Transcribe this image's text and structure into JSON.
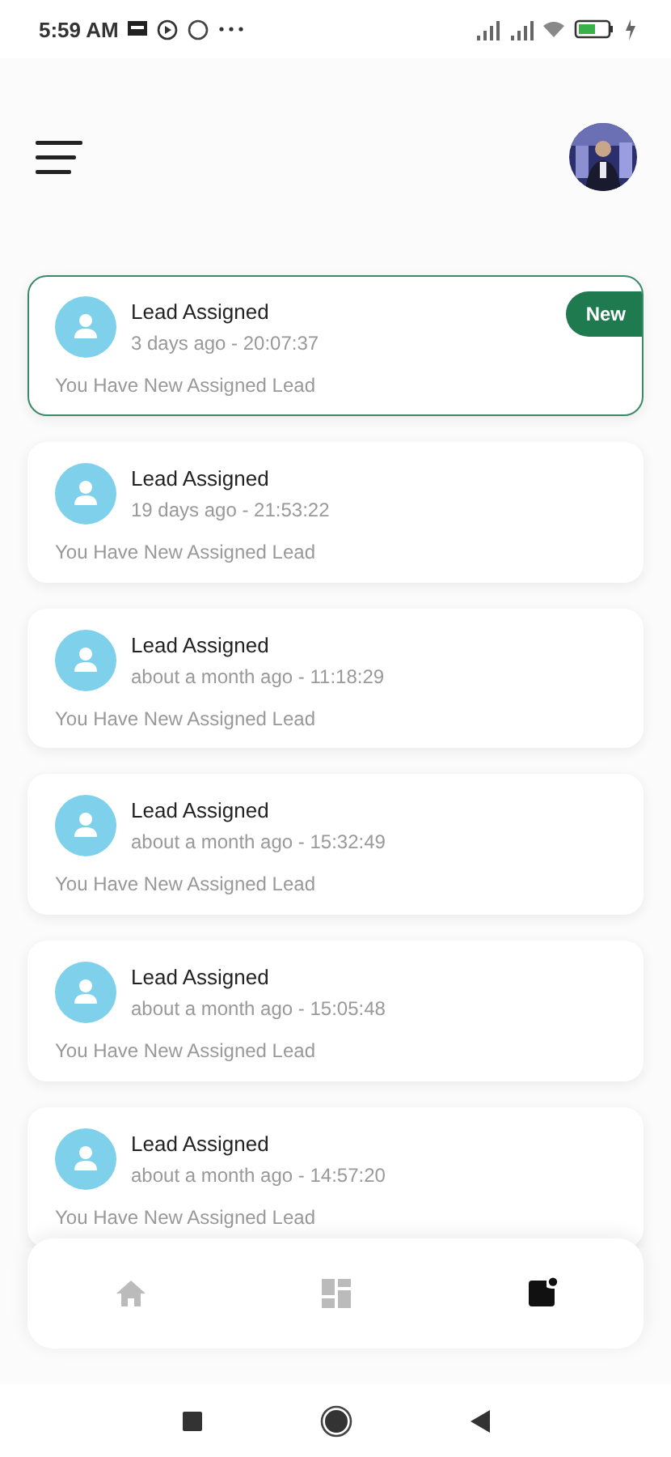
{
  "status_bar": {
    "time": "5:59 AM"
  },
  "new_badge": "New",
  "notifications": [
    {
      "title": "Lead Assigned",
      "time": "3 days ago - 20:07:37",
      "message": "You Have New Assigned Lead",
      "new": true
    },
    {
      "title": "Lead Assigned",
      "time": "19 days ago - 21:53:22",
      "message": "You Have New Assigned Lead",
      "new": false
    },
    {
      "title": "Lead Assigned",
      "time": "about a month ago - 11:18:29",
      "message": "You Have New Assigned Lead",
      "new": false
    },
    {
      "title": "Lead Assigned",
      "time": "about a month ago - 15:32:49",
      "message": "You Have New Assigned Lead",
      "new": false
    },
    {
      "title": "Lead Assigned",
      "time": "about a month ago - 15:05:48",
      "message": "You Have New Assigned Lead",
      "new": false
    },
    {
      "title": "Lead Assigned",
      "time": "about a month ago - 14:57:20",
      "message": "You Have New Assigned Lead",
      "new": false
    }
  ],
  "bottom_nav": [
    {
      "kind": "home",
      "selected": false
    },
    {
      "kind": "dashboard",
      "selected": false
    },
    {
      "kind": "notifications",
      "selected": true
    }
  ]
}
